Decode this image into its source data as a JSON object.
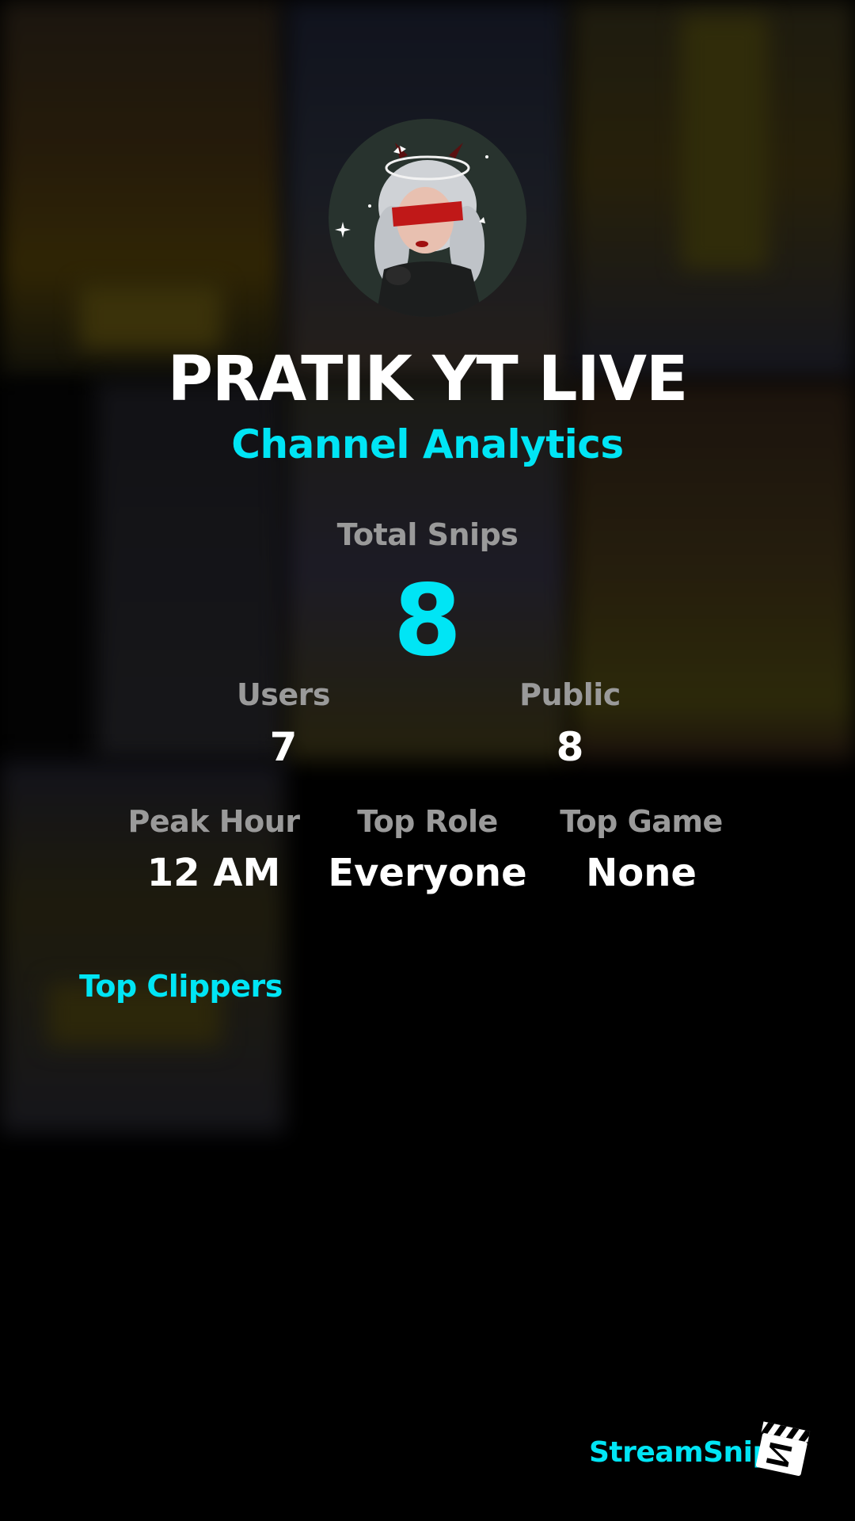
{
  "theme": {
    "accent": "#00e5f5",
    "background": "#000000",
    "label_color": "#9a9a9a",
    "value_color": "#ffffff"
  },
  "header": {
    "channel_name": "PRATIK YT LIVE",
    "subtitle": "Channel Analytics"
  },
  "stats": {
    "total_snips_label": "Total Snips",
    "total_snips_value": "8",
    "users_label": "Users",
    "users_value": "7",
    "public_label": "Public",
    "public_value": "8",
    "peak_hour_label": "Peak Hour",
    "peak_hour_value": "12 AM",
    "top_role_label": "Top Role",
    "top_role_value": "Everyone",
    "top_game_label": "Top Game",
    "top_game_value": "None"
  },
  "sections": {
    "top_clippers_title": "Top Clippers"
  },
  "brand": {
    "name": "StreamSnip",
    "logo_icon": "clapperboard-icon"
  }
}
